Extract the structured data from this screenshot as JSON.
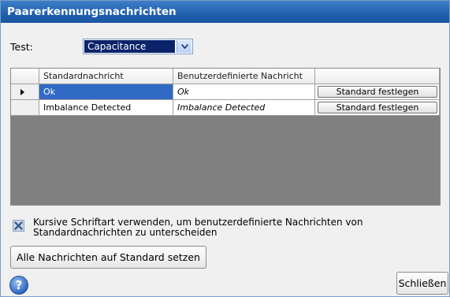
{
  "window": {
    "title": "Paarerkennungsnachrichten"
  },
  "test": {
    "label": "Test:",
    "selected": "Capacitance"
  },
  "table": {
    "headers": [
      "",
      "Standardnachricht",
      "Benutzerdefinierte Nachricht",
      ""
    ],
    "rows": [
      {
        "standard": "Ok",
        "custom": "Ok",
        "button": "Standard festlegen",
        "selected": true
      },
      {
        "standard": "Imbalance Detected",
        "custom": "Imbalance Detected",
        "button": "Standard festlegen",
        "selected": false
      }
    ]
  },
  "options": {
    "italic_checkbox_label": "Kursive Schriftart verwenden, um benutzerdefinierte Nachrichten von Standardnachrichten zu unterscheiden",
    "italic_checked": true
  },
  "buttons": {
    "reset_all": "Alle Nachrichten auf Standard setzen",
    "close": "Schließen",
    "help": "?"
  },
  "colors": {
    "title_bar": "#1f5fae",
    "selection": "#316ac5",
    "grid_background": "#808080"
  }
}
